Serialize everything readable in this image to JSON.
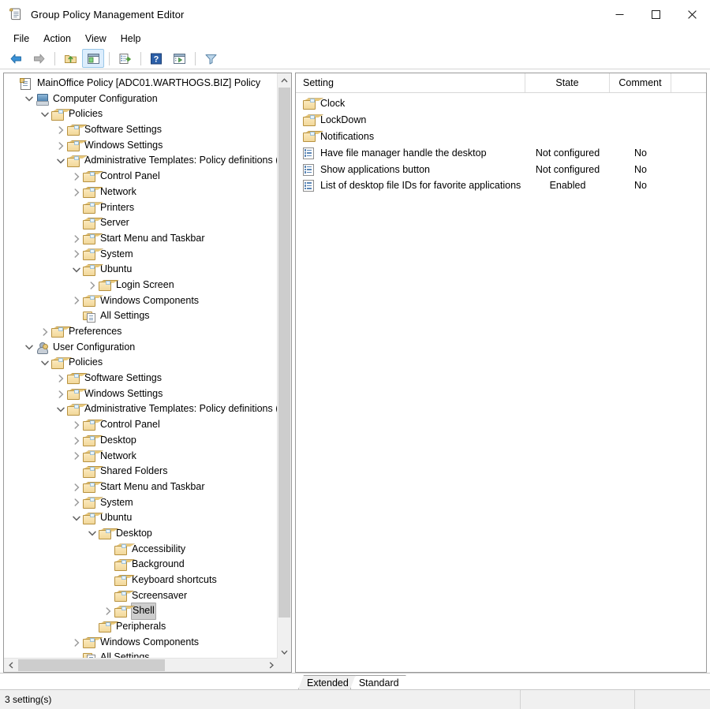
{
  "window": {
    "title": "Group Policy Management Editor",
    "icon": "policy-scroll-icon",
    "controls": {
      "minimize": "Minimize",
      "maximize": "Maximize",
      "close": "Close"
    }
  },
  "menubar": {
    "items": [
      "File",
      "Action",
      "View",
      "Help"
    ]
  },
  "toolbar": {
    "buttons": [
      {
        "name": "back-icon",
        "glyph": "back",
        "active": false
      },
      {
        "name": "forward-icon",
        "glyph": "forward",
        "active": false
      },
      {
        "name": "up-one-level-icon",
        "glyph": "folderup",
        "active": false
      },
      {
        "name": "show-hide-tree-icon",
        "glyph": "pane",
        "active": true
      },
      {
        "name": "export-list-icon",
        "glyph": "export",
        "active": false
      },
      {
        "name": "help-icon",
        "glyph": "help",
        "active": false
      },
      {
        "name": "show-hide-action-pane-icon",
        "glyph": "actionpane",
        "active": false
      },
      {
        "name": "filter-icon",
        "glyph": "filter",
        "active": false
      }
    ]
  },
  "tree": {
    "nodes": [
      {
        "label": "MainOffice Policy [ADC01.WARTHOGS.BIZ] Policy",
        "depth": 0,
        "icon": "policy-scroll-icon",
        "twisty": "none",
        "selected": false
      },
      {
        "label": "Computer Configuration",
        "depth": 1,
        "icon": "computer-icon",
        "twisty": "expanded",
        "selected": false
      },
      {
        "label": "Policies",
        "depth": 2,
        "icon": "folder-icon",
        "twisty": "expanded",
        "selected": false
      },
      {
        "label": "Software Settings",
        "depth": 3,
        "icon": "folder-icon",
        "twisty": "collapsed",
        "selected": false
      },
      {
        "label": "Windows Settings",
        "depth": 3,
        "icon": "folder-icon",
        "twisty": "collapsed",
        "selected": false
      },
      {
        "label": "Administrative Templates: Policy definitions (A",
        "depth": 3,
        "icon": "folder-icon",
        "twisty": "expanded",
        "selected": false
      },
      {
        "label": "Control Panel",
        "depth": 4,
        "icon": "folder-icon",
        "twisty": "collapsed",
        "selected": false
      },
      {
        "label": "Network",
        "depth": 4,
        "icon": "folder-icon",
        "twisty": "collapsed",
        "selected": false
      },
      {
        "label": "Printers",
        "depth": 4,
        "icon": "folder-icon",
        "twisty": "none",
        "selected": false
      },
      {
        "label": "Server",
        "depth": 4,
        "icon": "folder-icon",
        "twisty": "none",
        "selected": false
      },
      {
        "label": "Start Menu and Taskbar",
        "depth": 4,
        "icon": "folder-icon",
        "twisty": "collapsed",
        "selected": false
      },
      {
        "label": "System",
        "depth": 4,
        "icon": "folder-icon",
        "twisty": "collapsed",
        "selected": false
      },
      {
        "label": "Ubuntu",
        "depth": 4,
        "icon": "folder-icon",
        "twisty": "expanded",
        "selected": false
      },
      {
        "label": "Login Screen",
        "depth": 5,
        "icon": "folder-icon",
        "twisty": "collapsed",
        "selected": false
      },
      {
        "label": "Windows Components",
        "depth": 4,
        "icon": "folder-icon",
        "twisty": "collapsed",
        "selected": false
      },
      {
        "label": "All Settings",
        "depth": 4,
        "icon": "all-settings-icon",
        "twisty": "none",
        "selected": false
      },
      {
        "label": "Preferences",
        "depth": 2,
        "icon": "folder-icon",
        "twisty": "collapsed",
        "selected": false
      },
      {
        "label": "User Configuration",
        "depth": 1,
        "icon": "user-icon",
        "twisty": "expanded",
        "selected": false
      },
      {
        "label": "Policies",
        "depth": 2,
        "icon": "folder-icon",
        "twisty": "expanded",
        "selected": false
      },
      {
        "label": "Software Settings",
        "depth": 3,
        "icon": "folder-icon",
        "twisty": "collapsed",
        "selected": false
      },
      {
        "label": "Windows Settings",
        "depth": 3,
        "icon": "folder-icon",
        "twisty": "collapsed",
        "selected": false
      },
      {
        "label": "Administrative Templates: Policy definitions (A",
        "depth": 3,
        "icon": "folder-icon",
        "twisty": "expanded",
        "selected": false
      },
      {
        "label": "Control Panel",
        "depth": 4,
        "icon": "folder-icon",
        "twisty": "collapsed",
        "selected": false
      },
      {
        "label": "Desktop",
        "depth": 4,
        "icon": "folder-icon",
        "twisty": "collapsed",
        "selected": false
      },
      {
        "label": "Network",
        "depth": 4,
        "icon": "folder-icon",
        "twisty": "collapsed",
        "selected": false
      },
      {
        "label": "Shared Folders",
        "depth": 4,
        "icon": "folder-icon",
        "twisty": "none",
        "selected": false
      },
      {
        "label": "Start Menu and Taskbar",
        "depth": 4,
        "icon": "folder-icon",
        "twisty": "collapsed",
        "selected": false
      },
      {
        "label": "System",
        "depth": 4,
        "icon": "folder-icon",
        "twisty": "collapsed",
        "selected": false
      },
      {
        "label": "Ubuntu",
        "depth": 4,
        "icon": "folder-icon",
        "twisty": "expanded",
        "selected": false
      },
      {
        "label": "Desktop",
        "depth": 5,
        "icon": "folder-icon",
        "twisty": "expanded",
        "selected": false
      },
      {
        "label": "Accessibility",
        "depth": 6,
        "icon": "folder-icon",
        "twisty": "none",
        "selected": false
      },
      {
        "label": "Background",
        "depth": 6,
        "icon": "folder-icon",
        "twisty": "none",
        "selected": false
      },
      {
        "label": "Keyboard shortcuts",
        "depth": 6,
        "icon": "folder-icon",
        "twisty": "none",
        "selected": false
      },
      {
        "label": "Screensaver",
        "depth": 6,
        "icon": "folder-icon",
        "twisty": "none",
        "selected": false
      },
      {
        "label": "Shell",
        "depth": 6,
        "icon": "folder-icon",
        "twisty": "collapsed",
        "selected": true
      },
      {
        "label": "Peripherals",
        "depth": 5,
        "icon": "folder-icon",
        "twisty": "none",
        "selected": false
      },
      {
        "label": "Windows Components",
        "depth": 4,
        "icon": "folder-icon",
        "twisty": "collapsed",
        "selected": false
      },
      {
        "label": "All Settings",
        "depth": 4,
        "icon": "all-settings-icon",
        "twisty": "none",
        "selected": false
      },
      {
        "label": "Preferences",
        "depth": 2,
        "icon": "folder-icon",
        "twisty": "collapsed",
        "selected": false
      }
    ]
  },
  "list": {
    "columns": [
      "Setting",
      "State",
      "Comment"
    ],
    "rows": [
      {
        "icon": "folder-icon",
        "setting": "Clock",
        "state": "",
        "comment": ""
      },
      {
        "icon": "folder-icon",
        "setting": "LockDown",
        "state": "",
        "comment": ""
      },
      {
        "icon": "folder-icon",
        "setting": "Notifications",
        "state": "",
        "comment": ""
      },
      {
        "icon": "policy-setting-icon",
        "setting": "Have file manager handle the desktop",
        "state": "Not configured",
        "comment": "No"
      },
      {
        "icon": "policy-setting-icon",
        "setting": "Show applications button",
        "state": "Not configured",
        "comment": "No"
      },
      {
        "icon": "policy-setting-icon",
        "setting": "List of desktop file IDs for favorite applications",
        "state": "Enabled",
        "comment": "No"
      }
    ]
  },
  "tabs": [
    {
      "label": "Extended",
      "active": false
    },
    {
      "label": "Standard",
      "active": true
    }
  ],
  "statusbar": {
    "text": "3 setting(s)",
    "segment2": "",
    "segment3": ""
  },
  "colors": {
    "selection_bg": "#cdcdcd",
    "toolbar_active_bg": "#dcedfd",
    "pane_border": "#9a9a9a",
    "scrollbar_thumb": "#cdcdcd",
    "status_bg": "#f0f0f0"
  }
}
